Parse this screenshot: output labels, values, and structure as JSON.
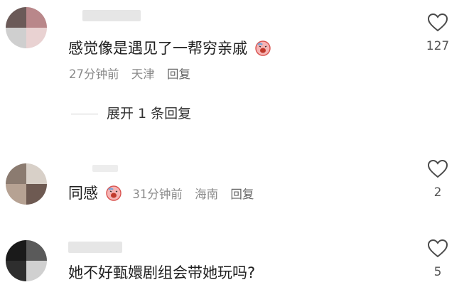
{
  "comments": [
    {
      "text": "感觉像是遇见了一帮穷亲戚",
      "meta": {
        "time": "27分钟前",
        "location": "天津",
        "reply": "回复"
      },
      "likes": "127",
      "emoji": "crying-face-emoji"
    },
    {
      "text": "同感",
      "meta": {
        "time": "31分钟前",
        "location": "海南",
        "reply": "回复"
      },
      "likes": "2",
      "emoji": "crying-face-emoji"
    },
    {
      "text": "她不好甄嬛剧组会带她玩吗?",
      "likes": "5"
    }
  ],
  "expand_replies": {
    "label": "展开 1 条回复"
  },
  "icons": {
    "like": "heart-outline-icon"
  },
  "colors": {
    "text": "#202020",
    "meta": "#8a8a8a",
    "background": "#ffffff"
  }
}
